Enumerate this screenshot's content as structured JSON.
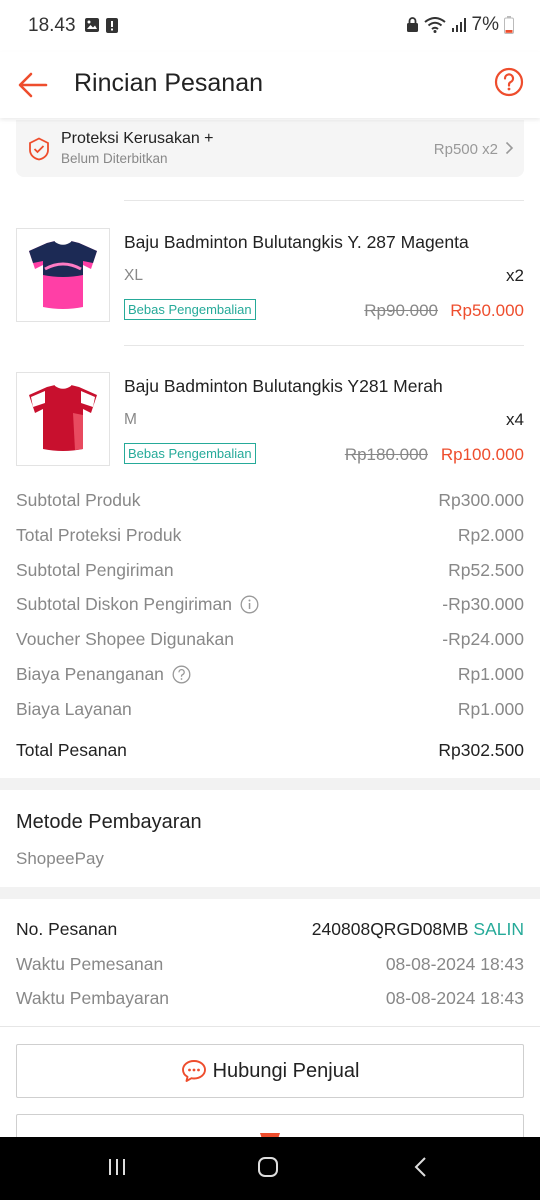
{
  "status_bar": {
    "time": "18.43",
    "battery": "7%"
  },
  "header": {
    "title": "Rincian Pesanan"
  },
  "protection": {
    "title": "Proteksi Kerusakan +",
    "subtitle": "Belum Diterbitkan",
    "price": "Rp500 x2"
  },
  "products": [
    {
      "name": "Baju Badminton Bulutangkis Y. 287 Magenta",
      "variant": "XL",
      "qty": "x2",
      "badge": "Bebas Pengembalian",
      "price_old": "Rp90.000",
      "price_new": "Rp50.000"
    },
    {
      "name": "Baju Badminton Bulutangkis Y281 Merah",
      "variant": "M",
      "qty": "x4",
      "badge": "Bebas Pengembalian",
      "price_old": "Rp180.000",
      "price_new": "Rp100.000"
    }
  ],
  "summary": [
    {
      "label": "Subtotal Produk",
      "value": "Rp300.000"
    },
    {
      "label": "Total Proteksi Produk",
      "value": "Rp2.000"
    },
    {
      "label": "Subtotal Pengiriman",
      "value": "Rp52.500"
    },
    {
      "label": "Subtotal Diskon Pengiriman",
      "value": "-Rp30.000"
    },
    {
      "label": "Voucher Shopee Digunakan",
      "value": "-Rp24.000"
    },
    {
      "label": "Biaya Penanganan",
      "value": "Rp1.000"
    },
    {
      "label": "Biaya Layanan",
      "value": "Rp1.000"
    }
  ],
  "total": {
    "label": "Total Pesanan",
    "value": "Rp302.500"
  },
  "payment": {
    "title": "Metode Pembayaran",
    "method": "ShopeePay"
  },
  "order_info": {
    "number_label": "No. Pesanan",
    "number_value": "240808QRGD08MB",
    "copy_label": "SALIN",
    "order_time_label": "Waktu Pemesanan",
    "order_time_value": "08-08-2024 18:43",
    "payment_time_label": "Waktu Pembayaran",
    "payment_time_value": "08-08-2024 18:43"
  },
  "actions": {
    "contact_seller": "Hubungi Penjual"
  },
  "colors": {
    "accent": "#ee4d2d",
    "teal": "#26aa99",
    "muted": "#888888"
  }
}
